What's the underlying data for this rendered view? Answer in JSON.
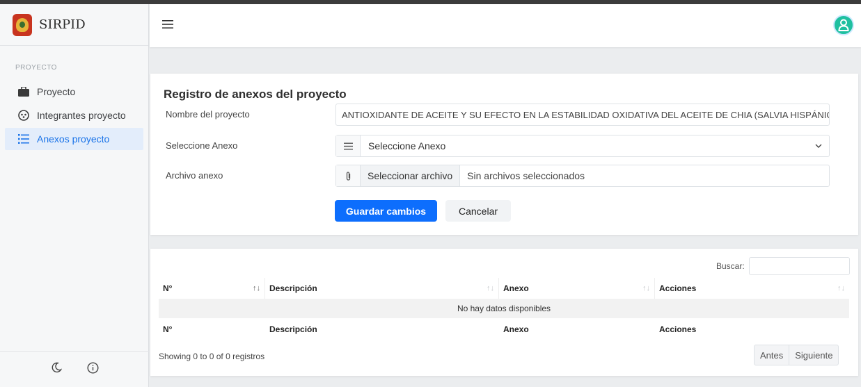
{
  "brand": {
    "name": "SIRPID",
    "logo_icon": "coat-of-arms"
  },
  "sidebar": {
    "section_label": "PROYECTO",
    "items": [
      {
        "label": "Proyecto",
        "icon": "briefcase-icon",
        "active": false
      },
      {
        "label": "Integrantes proyecto",
        "icon": "group-icon",
        "active": false
      },
      {
        "label": "Anexos proyecto",
        "icon": "list-icon",
        "active": true
      }
    ],
    "bottom_icons": [
      "moon-icon",
      "info-icon"
    ]
  },
  "header": {
    "menu_icon": "hamburger-icon",
    "avatar_icon": "user-icon"
  },
  "form": {
    "title": "Registro de anexos del proyecto",
    "project_name_label": "Nombre del proyecto",
    "project_name_value": "ANTIOXIDANTE DE ACEITE Y SU EFECTO EN LA ESTABILIDAD OXIDATIVA DEL ACEITE DE CHIA (SALVIA HISPÁNICA L.",
    "annex_label": "Seleccione Anexo",
    "annex_selected": "Seleccione Anexo",
    "file_label": "Archivo anexo",
    "file_button": "Seleccionar archivo",
    "file_status": "Sin archivos seleccionados",
    "save_button": "Guardar cambios",
    "cancel_button": "Cancelar"
  },
  "table": {
    "search_label": "Buscar:",
    "columns": [
      "N°",
      "Descripción",
      "Anexo",
      "Acciones"
    ],
    "empty_message": "No hay datos disponibles",
    "showing": "Showing 0 to 0 of 0 registros",
    "prev": "Antes",
    "next": "Siguiente"
  },
  "colors": {
    "accent": "#0d6efd",
    "active_nav": "#1a73e8",
    "avatar": "#1fc0a0"
  }
}
